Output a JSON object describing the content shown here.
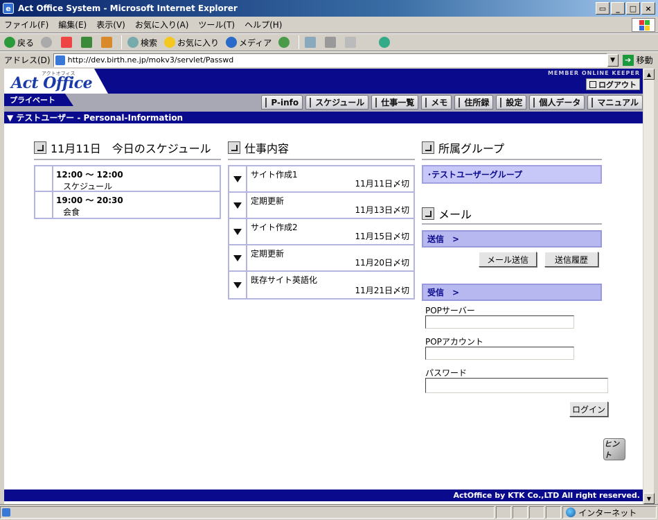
{
  "window": {
    "title": "Act Office System - Microsoft Internet Explorer",
    "controls": [
      "▭",
      "_",
      "□",
      "×"
    ]
  },
  "menu": [
    "ファイル(F)",
    "編集(E)",
    "表示(V)",
    "お気に入り(A)",
    "ツール(T)",
    "ヘルプ(H)"
  ],
  "toolbar": {
    "back": "戻る",
    "search": "検索",
    "favorites": "お気に入り",
    "media": "メディア"
  },
  "address": {
    "label": "アドレス(D)",
    "url": "http://dev.birth.ne.jp/mokv3/servlet/Passwd",
    "go": "移動"
  },
  "site": {
    "logo": "Act Office",
    "logo_sub": "アクトオフィス",
    "tagline": "MEMBER ONLINE KEEPER",
    "logout": "ログアウト",
    "private": "プライベート",
    "nav": [
      "P-info",
      "スケジュール",
      "仕事一覧",
      "メモ",
      "住所録",
      "設定",
      "個人データ",
      "マニュアル"
    ],
    "section": "▼ テストユーザー - Personal-Information"
  },
  "schedule": {
    "title": "11月11日　今日のスケジュール",
    "items": [
      {
        "time": "12:00 〜 12:00",
        "name": "スケジュール"
      },
      {
        "time": "19:00 〜 20:30",
        "name": "会食"
      }
    ]
  },
  "jobs": {
    "title": "仕事内容",
    "items": [
      {
        "name": "サイト作成1",
        "due": "11月11日〆切"
      },
      {
        "name": "定期更新",
        "due": "11月13日〆切"
      },
      {
        "name": "サイト作成2",
        "due": "11月15日〆切"
      },
      {
        "name": "定期更新",
        "due": "11月20日〆切"
      },
      {
        "name": "既存サイト英語化",
        "due": "11月21日〆切"
      }
    ]
  },
  "group": {
    "title": "所属グループ",
    "name": "･テストユーザーグループ"
  },
  "mail": {
    "title": "メール",
    "send_bar": "送信　>",
    "send_button": "メール送信",
    "history_button": "送信履歴",
    "receive_bar": "受信　>",
    "pop_server_label": "POPサーバー",
    "pop_account_label": "POPアカウント",
    "password_label": "パスワード",
    "login_button": "ログイン"
  },
  "hint": "ヒント",
  "footer": "ActOffice by KTK Co.,LTD All right reserved.",
  "status": {
    "zone": "インターネット"
  }
}
